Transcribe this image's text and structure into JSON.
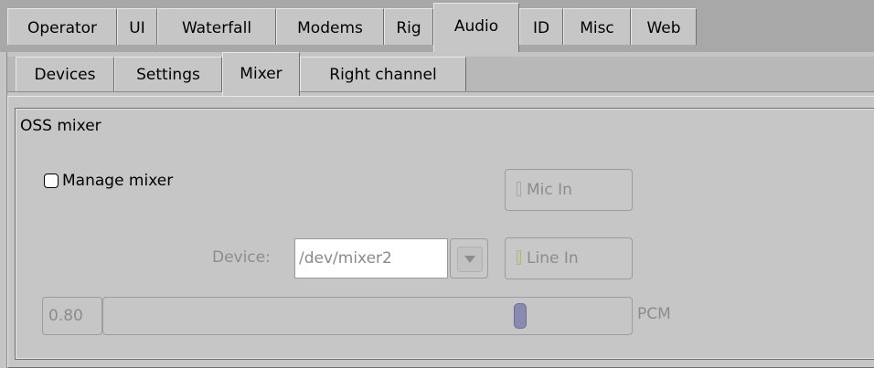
{
  "top_tabs": [
    {
      "label": "Operator",
      "active": false
    },
    {
      "label": "UI",
      "active": false
    },
    {
      "label": "Waterfall",
      "active": false
    },
    {
      "label": "Modems",
      "active": false
    },
    {
      "label": "Rig",
      "active": false
    },
    {
      "label": "Audio",
      "active": true
    },
    {
      "label": "ID",
      "active": false
    },
    {
      "label": "Misc",
      "active": false
    },
    {
      "label": "Web",
      "active": false
    }
  ],
  "sub_tabs": [
    {
      "label": "Devices",
      "active": false
    },
    {
      "label": "Settings",
      "active": false
    },
    {
      "label": "Mixer",
      "active": true
    },
    {
      "label": "Right channel",
      "active": false
    }
  ],
  "group": {
    "title": "OSS mixer",
    "manage_mixer_label": "Manage mixer",
    "manage_mixer_checked": false,
    "mic_in_label": "Mic In",
    "line_in_label": "Line In",
    "device_label": "Device:",
    "device_value": "/dev/mixer2",
    "pcm_value": "0.80",
    "pcm_label": "PCM"
  },
  "colors": {
    "background": "#c6c6c6",
    "disabled_text": "#8c8c8c",
    "slider_thumb": "#8a8ab0"
  }
}
